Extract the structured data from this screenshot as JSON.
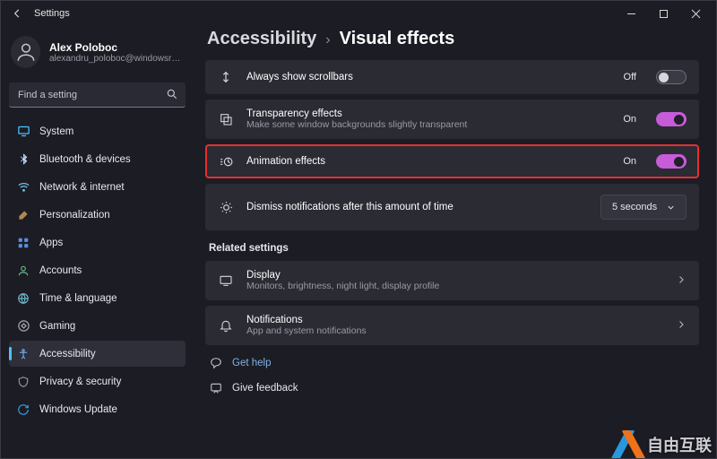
{
  "window": {
    "title": "Settings"
  },
  "user": {
    "name": "Alex Poloboc",
    "email": "alexandru_poloboc@windowsreport..."
  },
  "search": {
    "placeholder": "Find a setting"
  },
  "nav": {
    "items": [
      {
        "label": "System"
      },
      {
        "label": "Bluetooth & devices"
      },
      {
        "label": "Network & internet"
      },
      {
        "label": "Personalization"
      },
      {
        "label": "Apps"
      },
      {
        "label": "Accounts"
      },
      {
        "label": "Time & language"
      },
      {
        "label": "Gaming"
      },
      {
        "label": "Accessibility"
      },
      {
        "label": "Privacy & security"
      },
      {
        "label": "Windows Update"
      }
    ]
  },
  "breadcrumb": {
    "parent": "Accessibility",
    "sep": "›",
    "current": "Visual effects"
  },
  "rows": {
    "scrollbars": {
      "label": "Always show scrollbars",
      "state": "Off"
    },
    "transparency": {
      "label": "Transparency effects",
      "sub": "Make some window backgrounds slightly transparent",
      "state": "On"
    },
    "animation": {
      "label": "Animation effects",
      "state": "On"
    },
    "dismiss": {
      "label": "Dismiss notifications after this amount of time",
      "value": "5 seconds"
    }
  },
  "related": {
    "title": "Related settings",
    "display": {
      "label": "Display",
      "sub": "Monitors, brightness, night light, display profile"
    },
    "notifications": {
      "label": "Notifications",
      "sub": "App and system notifications"
    }
  },
  "footer": {
    "help": "Get help",
    "feedback": "Give feedback"
  },
  "watermark": "自由互联"
}
